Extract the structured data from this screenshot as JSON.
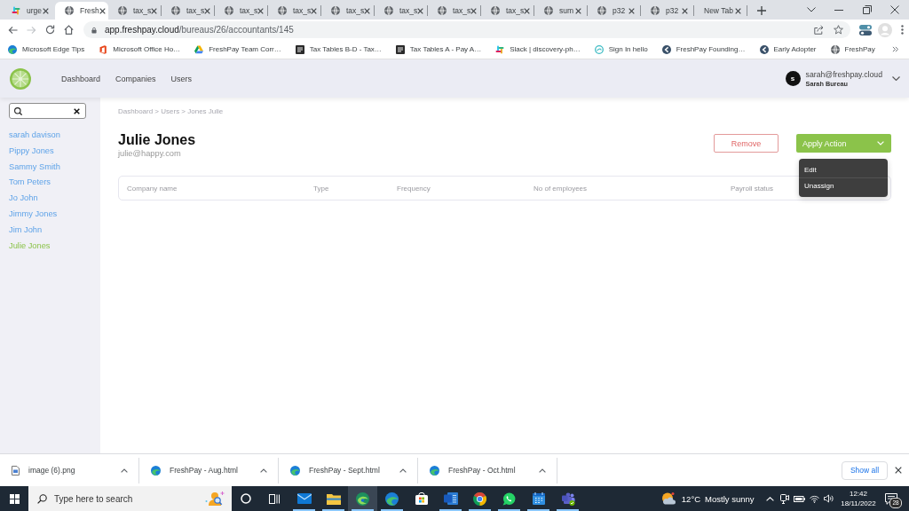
{
  "browser": {
    "tabs": [
      {
        "kind": "slack",
        "title": "urge",
        "selected": false
      },
      {
        "kind": "globe",
        "title": "Fresh",
        "selected": true
      },
      {
        "kind": "globe",
        "title": "tax_s",
        "selected": false
      },
      {
        "kind": "globe",
        "title": "tax_s",
        "selected": false
      },
      {
        "kind": "globe",
        "title": "tax_s",
        "selected": false
      },
      {
        "kind": "globe",
        "title": "tax_s",
        "selected": false
      },
      {
        "kind": "globe",
        "title": "tax_s",
        "selected": false
      },
      {
        "kind": "globe",
        "title": "tax_s",
        "selected": false
      },
      {
        "kind": "globe",
        "title": "tax_s",
        "selected": false
      },
      {
        "kind": "globe",
        "title": "tax_s",
        "selected": false
      },
      {
        "kind": "globe",
        "title": "sum",
        "selected": false
      },
      {
        "kind": "globe",
        "title": "p32",
        "selected": false
      },
      {
        "kind": "globe",
        "title": "p32",
        "selected": false
      },
      {
        "kind": "blank",
        "title": "New Tab",
        "selected": false
      }
    ],
    "nav_buttons": [
      {
        "kind": "back",
        "disabled": false
      },
      {
        "kind": "forward",
        "disabled": true
      },
      {
        "kind": "reload",
        "disabled": false
      },
      {
        "kind": "home",
        "disabled": false
      }
    ],
    "address": {
      "domain": "app.freshpay.cloud",
      "path": "/bureaus/26/accountants/145"
    },
    "bookmarks": [
      {
        "kind": "edge",
        "label": "Microsoft Edge Tips"
      },
      {
        "kind": "office",
        "label": "Microsoft Office Ho…"
      },
      {
        "kind": "drive",
        "label": "FreshPay Team Corr…"
      },
      {
        "kind": "tile",
        "label": "Tax Tables B-D - Tax…"
      },
      {
        "kind": "tile",
        "label": "Tax Tables A - Pay A…"
      },
      {
        "kind": "slack",
        "label": "Slack | discovery-ph…"
      },
      {
        "kind": "swirl",
        "label": "Sign In hello"
      },
      {
        "kind": "roundel",
        "label": "FreshPay Founding…"
      },
      {
        "kind": "roundel",
        "label": "Early Adopter"
      },
      {
        "kind": "globe",
        "label": "FreshPay"
      }
    ]
  },
  "app": {
    "nav": [
      "Dashboard",
      "Companies",
      "Users"
    ],
    "account": {
      "initial": "s",
      "email": "sarah@freshpay.cloud",
      "name": "Sarah Bureau"
    },
    "sidebar": {
      "users": [
        {
          "name": "sarah davison",
          "selected": false
        },
        {
          "name": "Pippy Jones",
          "selected": false
        },
        {
          "name": "Sammy Smith",
          "selected": false
        },
        {
          "name": "Tom Peters",
          "selected": false
        },
        {
          "name": "Jo John",
          "selected": false
        },
        {
          "name": "Jimmy Jones",
          "selected": false
        },
        {
          "name": "Jim John",
          "selected": false
        },
        {
          "name": "Julie Jones",
          "selected": true
        }
      ]
    },
    "breadcrumb": "Dashboard > Users > Jones Julie",
    "user": {
      "name": "Julie Jones",
      "email": "julie@happy.com"
    },
    "remove_button": "Remove",
    "apply_action": {
      "label": "Apply Action",
      "expanded": true,
      "menu": [
        "Edit",
        "Unassign"
      ]
    },
    "table": {
      "columns": [
        "Company name",
        "Type",
        "Frequency",
        "No of employees",
        "Payroll status"
      ]
    }
  },
  "downloads": {
    "items": [
      {
        "kind": "image",
        "name": "image (6).png"
      },
      {
        "kind": "edge",
        "name": "FreshPay - Aug.html"
      },
      {
        "kind": "edge",
        "name": "FreshPay - Sept.html"
      },
      {
        "kind": "edge",
        "name": "FreshPay - Oct.html"
      }
    ],
    "show_all": "Show all"
  },
  "taskbar": {
    "search": {
      "placeholder": "Type here to search"
    },
    "apps": [
      {
        "kind": "mail",
        "running": true,
        "selected": false
      },
      {
        "kind": "folder",
        "running": true,
        "selected": false
      },
      {
        "kind": "swirl",
        "running": true,
        "selected": true
      },
      {
        "kind": "edge",
        "running": true,
        "selected": false
      },
      {
        "kind": "store",
        "running": false,
        "selected": false
      },
      {
        "kind": "word",
        "running": true,
        "selected": false
      },
      {
        "kind": "chrome",
        "running": true,
        "selected": false
      },
      {
        "kind": "whatsapp",
        "running": true,
        "selected": false
      },
      {
        "kind": "calendar",
        "running": true,
        "selected": false
      },
      {
        "kind": "teams",
        "running": true,
        "selected": false
      }
    ],
    "weather": {
      "temperature": "12°C",
      "condition": "Mostly sunny"
    },
    "clock": {
      "time": "12:42",
      "date": "18/11/2022"
    },
    "notifications": "28"
  }
}
